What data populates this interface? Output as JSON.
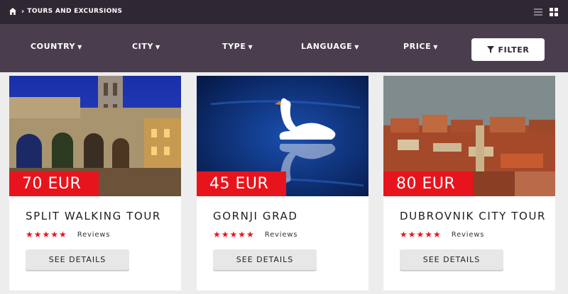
{
  "breadcrumb": {
    "text": "TOURS AND EXCURSIONS",
    "home_icon": "home-icon"
  },
  "view_toggle": {
    "list_icon": "list-view-icon",
    "grid_icon": "grid-view-icon"
  },
  "filters": {
    "items": [
      {
        "label": "COUNTRY"
      },
      {
        "label": "CITY"
      },
      {
        "label": "TYPE"
      },
      {
        "label": "LANGUAGE"
      },
      {
        "label": "PRICE"
      }
    ],
    "filter_button": "FILTER"
  },
  "tours": [
    {
      "price": "70 EUR",
      "title": "SPLIT WALKING TOUR",
      "stars": "★★★★★",
      "reviews": "Reviews",
      "button": "SEE DETAILS"
    },
    {
      "price": "45 EUR",
      "title": "GORNJI GRAD",
      "stars": "★★★★★",
      "reviews": "Reviews",
      "button": "SEE DETAILS"
    },
    {
      "price": "80 EUR",
      "title": "DUBROVNIK CITY TOUR",
      "stars": "★★★★★",
      "reviews": "Reviews",
      "button": "SEE DETAILS"
    }
  ],
  "colors": {
    "topbar": "#2f2733",
    "filterbar": "#4a3e4e",
    "price_badge": "#e8141d",
    "stars": "#e8141d"
  }
}
